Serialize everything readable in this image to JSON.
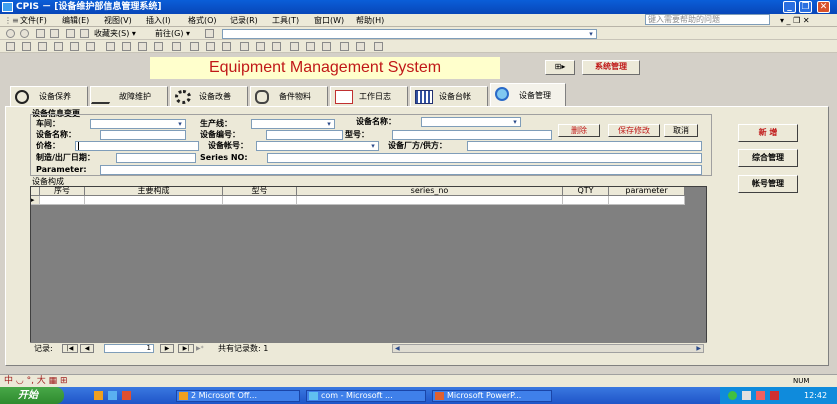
{
  "window": {
    "title": "CPIS － [设备维护部信息管理系统]"
  },
  "menu": {
    "items": [
      "文件(F)",
      "编辑(E)",
      "视图(V)",
      "插入(I)",
      "格式(O)",
      "记录(R)",
      "工具(T)",
      "窗口(W)",
      "帮助(H)"
    ],
    "help_placeholder": "键入需要帮助的问题"
  },
  "toolbar": {
    "favorites": "收藏夹(S) ▾",
    "goto": "前往(G) ▾"
  },
  "app": {
    "title": "Equipment Management System",
    "sys_mgmt": "系统管理"
  },
  "tabs": [
    "设备保养",
    "故障维护",
    "设备改善",
    "备件物料",
    "工作日志",
    "设备台帐",
    "设备管理"
  ],
  "form": {
    "section_title": "设备信息变更",
    "workshop": "车间：",
    "production_line": "生产线：",
    "equipment_name_top": "设备名称：",
    "equipment_name": "设备名称：",
    "equipment_no": "设备编号：",
    "model": "型号：",
    "price": "价格：",
    "account_no": "设备帐号：",
    "manufacturer": "设备厂方/供方：",
    "mfg_date": "制造/出厂日期：",
    "series_no": "Series NO:",
    "parameter": "Parameter:",
    "structure_title": "设备构成"
  },
  "actions": {
    "delete": "删除",
    "save": "保存修改",
    "cancel": "取消",
    "add": "新 增",
    "general": "综合管理",
    "account_mgmt": "帐号管理"
  },
  "grid": {
    "columns": [
      "序号",
      "主要构成",
      "型号",
      "series_no",
      "QTY",
      "parameter"
    ]
  },
  "recnav": {
    "label": "记录:",
    "current": "1",
    "total": "共有记录数: 1"
  },
  "ime": {
    "text": "中 ◡ °, 大 ▦ ⊞"
  },
  "statusbar": {
    "num": "NUM"
  },
  "taskbar": {
    "start": "开始",
    "tasks": [
      "2 Microsoft Off...",
      "com - Microsoft ...",
      "Microsoft PowerP..."
    ],
    "clock": "12:42"
  }
}
